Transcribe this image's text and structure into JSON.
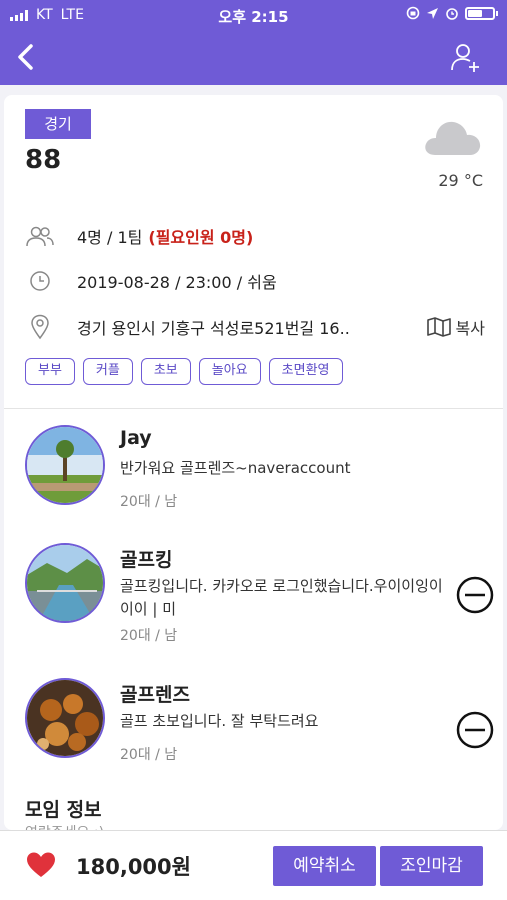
{
  "status_bar": {
    "carrier": "KT",
    "network": "LTE",
    "time": "오후 2:15",
    "battery_level": 0.6
  },
  "nav": {
    "back_icon": "chevron-left-icon",
    "add_user_icon": "add-user-icon"
  },
  "meeting": {
    "region": "경기",
    "title": "88",
    "weather_icon": "cloud-icon",
    "temperature": "29 °C",
    "people": "4명 / 1팀",
    "needed": "(필요인원 0명)",
    "datetime": "2019-08-28 / 23:00 / 쉬움",
    "address": "경기 용인시 기흥구 석성로521번길 16..",
    "copy_label": "복사",
    "tags": [
      "부부",
      "커플",
      "초보",
      "놀아요",
      "초면환영"
    ]
  },
  "members": [
    {
      "name": "Jay",
      "intro": "반가워요 골프렌즈~naveraccount",
      "meta": "20대 / 남",
      "removable": false
    },
    {
      "name": "골프킹",
      "intro": "골프킹입니다. 카카오로 로그인했습니다.우이이잉이이이 | 미",
      "meta": "20대 / 남",
      "removable": true
    },
    {
      "name": "골프렌즈",
      "intro": "골프 초보입니다. 잘 부탁드려요",
      "meta": "20대 / 남",
      "removable": true
    }
  ],
  "info_section": {
    "title": "모임 정보",
    "subtitle": "연락주세요 :)"
  },
  "bottom_bar": {
    "price": "180,000원",
    "cancel_label": "예약취소",
    "close_label": "조인마감"
  },
  "colors": {
    "accent": "#6f5bd6",
    "needed_text": "#c8221a",
    "heart": "#e0323b"
  }
}
